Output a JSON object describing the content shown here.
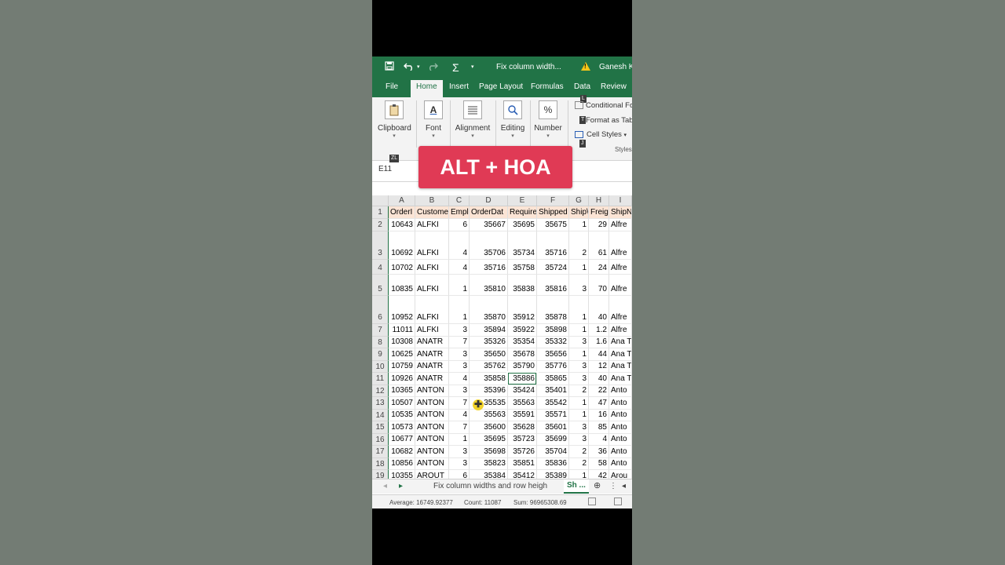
{
  "titlebar": {
    "save_icon": "save-icon",
    "undo_icon": "undo-icon",
    "redo_icon": "redo-icon",
    "autosum_icon": "Σ",
    "title": "Fix column width...",
    "warning": "!",
    "user": "Ganesh K"
  },
  "tabs": [
    "File",
    "Home",
    "Insert",
    "Page Layout",
    "Formulas",
    "Data",
    "Review"
  ],
  "ribbon": {
    "groups": [
      {
        "label": "Clipboard",
        "icon": "clipboard-icon"
      },
      {
        "label": "Font",
        "icon": "font-icon"
      },
      {
        "label": "Alignment",
        "icon": "alignment-icon"
      },
      {
        "label": "Editing",
        "icon": "editing-icon"
      },
      {
        "label": "Number",
        "icon": "%"
      }
    ],
    "styles": {
      "conditional": "Conditional Fo",
      "format_table": "Format as Tab",
      "cell_styles": "Cell Styles",
      "group_label": "Styles"
    },
    "keytips": {
      "L": "L",
      "T": "T",
      "J": "J",
      "ZL": "ZL"
    }
  },
  "formula": {
    "namebox": "E11"
  },
  "overlay": {
    "text": "ALT + HOA"
  },
  "grid": {
    "columns": [
      "A",
      "B",
      "C",
      "D",
      "E",
      "F",
      "G",
      "H",
      "I"
    ],
    "header_row": [
      "OrderI",
      "Custome",
      "Empl",
      "OrderDat",
      "Require",
      "Shipped",
      "Ship\\",
      "Freig",
      "ShipN"
    ],
    "rows": [
      [
        "2",
        "10643",
        "ALFKI",
        "6",
        "35667",
        "35695",
        "35675",
        "1",
        "29",
        "Alfre"
      ],
      [
        "3",
        "10692",
        "ALFKI",
        "4",
        "35706",
        "35734",
        "35716",
        "2",
        "61",
        "Alfre"
      ],
      [
        "4",
        "10702",
        "ALFKI",
        "4",
        "35716",
        "35758",
        "35724",
        "1",
        "24",
        "Alfre"
      ],
      [
        "5",
        "10835",
        "ALFKI",
        "1",
        "35810",
        "35838",
        "35816",
        "3",
        "70",
        "Alfre"
      ],
      [
        "6",
        "10952",
        "ALFKI",
        "1",
        "35870",
        "35912",
        "35878",
        "1",
        "40",
        "Alfre"
      ],
      [
        "7",
        "11011",
        "ALFKI",
        "3",
        "35894",
        "35922",
        "35898",
        "1",
        "1.2",
        "Alfre"
      ],
      [
        "8",
        "10308",
        "ANATR",
        "7",
        "35326",
        "35354",
        "35332",
        "3",
        "1.6",
        "Ana T"
      ],
      [
        "9",
        "10625",
        "ANATR",
        "3",
        "35650",
        "35678",
        "35656",
        "1",
        "44",
        "Ana T"
      ],
      [
        "10",
        "10759",
        "ANATR",
        "3",
        "35762",
        "35790",
        "35776",
        "3",
        "12",
        "Ana T"
      ],
      [
        "11",
        "10926",
        "ANATR",
        "4",
        "35858",
        "35886",
        "35865",
        "3",
        "40",
        "Ana T"
      ],
      [
        "12",
        "10365",
        "ANTON",
        "3",
        "35396",
        "35424",
        "35401",
        "2",
        "22",
        "Anto"
      ],
      [
        "13",
        "10507",
        "ANTON",
        "7",
        "35535",
        "35563",
        "35542",
        "1",
        "47",
        "Anto"
      ],
      [
        "14",
        "10535",
        "ANTON",
        "4",
        "35563",
        "35591",
        "35571",
        "1",
        "16",
        "Anto"
      ],
      [
        "15",
        "10573",
        "ANTON",
        "7",
        "35600",
        "35628",
        "35601",
        "3",
        "85",
        "Anto"
      ],
      [
        "16",
        "10677",
        "ANTON",
        "1",
        "35695",
        "35723",
        "35699",
        "3",
        "4",
        "Anto"
      ],
      [
        "17",
        "10682",
        "ANTON",
        "3",
        "35698",
        "35726",
        "35704",
        "2",
        "36",
        "Anto"
      ],
      [
        "18",
        "10856",
        "ANTON",
        "3",
        "35823",
        "35851",
        "35836",
        "2",
        "58",
        "Anto"
      ],
      [
        "19",
        "10355",
        "AROUT",
        "6",
        "35384",
        "35412",
        "35389",
        "1",
        "42",
        "Arou"
      ]
    ]
  },
  "sheetbar": {
    "sheet1": "Fix column widths and row heigh",
    "sheet2": "Sh ..."
  },
  "status": {
    "average": "Average: 16749.92377",
    "count": "Count: 11087",
    "sum": "Sum: 96965308.69"
  }
}
